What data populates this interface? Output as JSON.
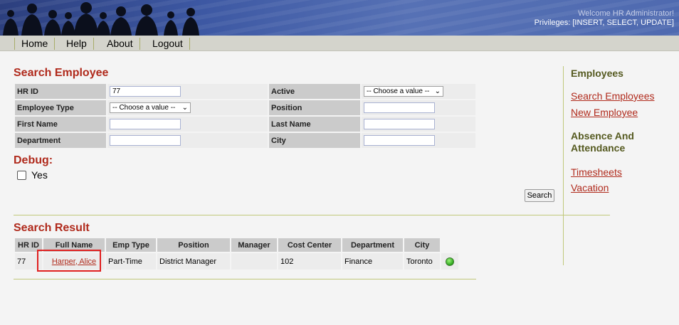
{
  "header": {
    "welcome": "Welcome HR Administrator!",
    "privileges": "Privileges: [INSERT, SELECT, UPDATE]"
  },
  "nav": {
    "home": "Home",
    "help": "Help",
    "about": "About",
    "logout": "Logout"
  },
  "search": {
    "title": "Search Employee",
    "fields": {
      "hr_id_label": "HR ID",
      "hr_id_value": "77",
      "active_label": "Active",
      "active_value": "-- Choose a value --",
      "emp_type_label": "Employee Type",
      "emp_type_value": "-- Choose a value --",
      "position_label": "Position",
      "first_name_label": "First Name",
      "last_name_label": "Last Name",
      "department_label": "Department",
      "city_label": "City"
    },
    "button": "Search"
  },
  "debug": {
    "title": "Debug:",
    "yes_label": "Yes"
  },
  "results": {
    "title": "Search Result",
    "columns": [
      "HR ID",
      "Full Name",
      "Emp Type",
      "Position",
      "Manager",
      "Cost Center",
      "Department",
      "City"
    ],
    "rows": [
      {
        "hr_id": "77",
        "full_name": "Harper, Alice",
        "emp_type": "Part-Time",
        "position": "District Manager",
        "manager": "",
        "cost_center": "102",
        "department": "Finance",
        "city": "Toronto",
        "status_color": "#2aa51b"
      }
    ]
  },
  "sidebar": {
    "employees_heading": "Employees",
    "search_employees": "Search Employees",
    "new_employee": "New Employee",
    "absence_heading_1": "Absence And",
    "absence_heading_2": "Attendance",
    "timesheets": "Timesheets",
    "vacation": "Vacation"
  },
  "colors": {
    "accent": "#b02a1c",
    "heading": "#555a20",
    "header_bg": "#3d58a3"
  }
}
